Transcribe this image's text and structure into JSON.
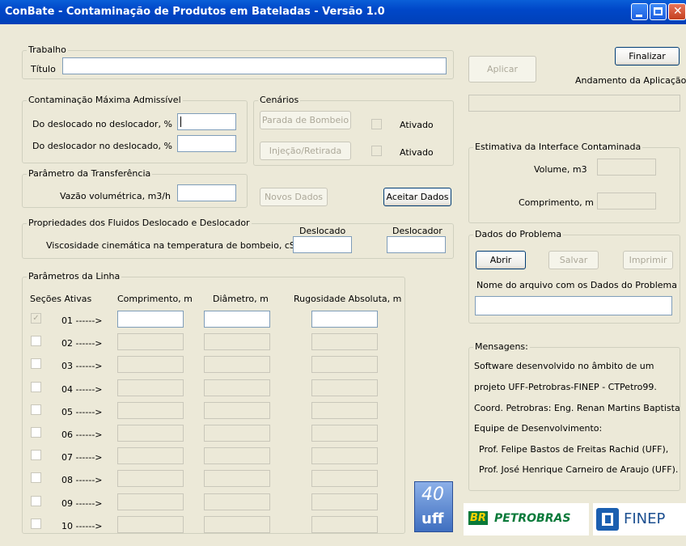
{
  "window": {
    "title": "ConBate - Contaminação de Produtos em Bateladas - Versão 1.0"
  },
  "trabalho": {
    "legend": "Trabalho",
    "titulo_label": "Título",
    "titulo_value": ""
  },
  "cma": {
    "legend": "Contaminação Máxima Admissível",
    "row1": "Do deslocado no deslocador, %",
    "row2": "Do deslocador no deslocado, %"
  },
  "cenarios": {
    "legend": "Cenários",
    "btn1": "Parada de Bombeio",
    "btn2": "Injeção/Retirada",
    "ativado1": "Ativado",
    "ativado2": "Ativado"
  },
  "transf": {
    "legend": "Parâmetro da Transferência",
    "vazao": "Vazão volumétrica, m3/h"
  },
  "buttons": {
    "novos": "Novos Dados",
    "aceitar": "Aceitar Dados",
    "aplicar": "Aplicar",
    "finalizar": "Finalizar"
  },
  "andamento": "Andamento da Aplicação",
  "props": {
    "legend": "Propriedades dos Fluidos Deslocado e Deslocador",
    "visc": "Viscosidade cinemática na temperatura de bombeio, cSt",
    "deslocado": "Deslocado",
    "deslocador": "Deslocador"
  },
  "linha": {
    "legend": "Parâmetros da Linha",
    "headers": {
      "secoes": "Seções Ativas",
      "comp": "Comprimento, m",
      "diam": "Diâmetro, m",
      "rug": "Rugosidade Absoluta, m"
    },
    "rows": [
      "01 ------>",
      "02 ------>",
      "03 ------>",
      "04 ------>",
      "05 ------>",
      "06 ------>",
      "07 ------>",
      "08 ------>",
      "09 ------>",
      "10 ------>"
    ]
  },
  "estimativa": {
    "legend": "Estimativa da Interface Contaminada",
    "volume": "Volume, m3",
    "comprimento": "Comprimento, m"
  },
  "dados": {
    "legend": "Dados do Problema",
    "abrir": "Abrir",
    "salvar": "Salvar",
    "imprimir": "Imprimir",
    "nome": "Nome do arquivo com os Dados do Problema"
  },
  "mensagens": {
    "legend": "Mensagens:",
    "lines": [
      "Software desenvolvido no âmbito de um",
      "projeto UFF-Petrobras-FINEP - CTPetro99.",
      "Coord. Petrobras: Eng. Renan Martins Baptista",
      "Equipe de Desenvolvimento:",
      "Prof. Felipe Bastos de Freitas Rachid (UFF),",
      "Prof. José Henrique Carneiro de Araujo (UFF)."
    ]
  },
  "logos": {
    "uff_top": "40",
    "uff_bottom": "uff",
    "br": "BR",
    "petrobras": "PETROBRAS",
    "finep": "FINEP"
  }
}
